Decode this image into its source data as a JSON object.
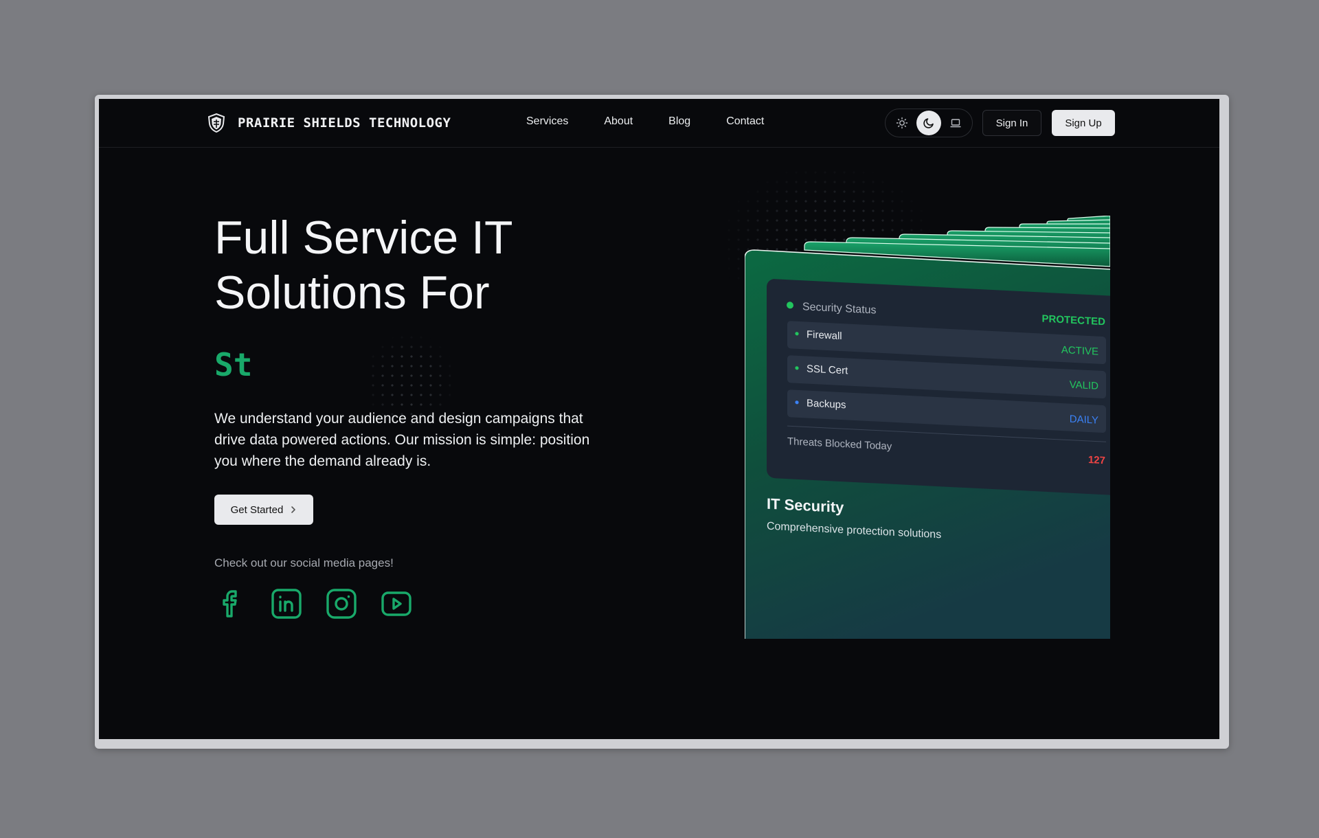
{
  "brand": {
    "name": "PRAIRIE SHIELDS TECHNOLOGY",
    "logo": "shield-logo-icon"
  },
  "nav": {
    "items": [
      {
        "label": "Services"
      },
      {
        "label": "About"
      },
      {
        "label": "Blog"
      },
      {
        "label": "Contact"
      }
    ]
  },
  "theme_toggle": {
    "options": [
      "sun-icon",
      "moon-icon",
      "laptop-icon"
    ],
    "selected": "moon-icon"
  },
  "auth": {
    "sign_in": "Sign In",
    "sign_up": "Sign Up"
  },
  "hero": {
    "headline_line1": "Full Service IT",
    "headline_line2": "Solutions For",
    "typed_text": "St",
    "description": "We understand your audience and design campaigns that drive data powered actions. Our mission is simple: position you where the demand already is.",
    "cta": "Get Started",
    "social_label": "Check out our social media pages!"
  },
  "socials": [
    "facebook-icon",
    "linkedin-icon",
    "instagram-icon",
    "youtube-icon"
  ],
  "card": {
    "status_label": "Security Status",
    "status_value": "PROTECTED",
    "rows": [
      {
        "label": "Firewall",
        "value": "ACTIVE",
        "color": "#22c55e"
      },
      {
        "label": "SSL Cert",
        "value": "VALID",
        "color": "#22c55e"
      },
      {
        "label": "Backups",
        "value": "DAILY",
        "color": "#3b82f6"
      }
    ],
    "threats_label": "Threats Blocked Today",
    "threats_value": "127",
    "title": "IT Security",
    "subtitle": "Comprehensive protection solutions"
  },
  "colors": {
    "accent": "#19a96a",
    "background": "#08090c",
    "threat": "#ef4444"
  }
}
